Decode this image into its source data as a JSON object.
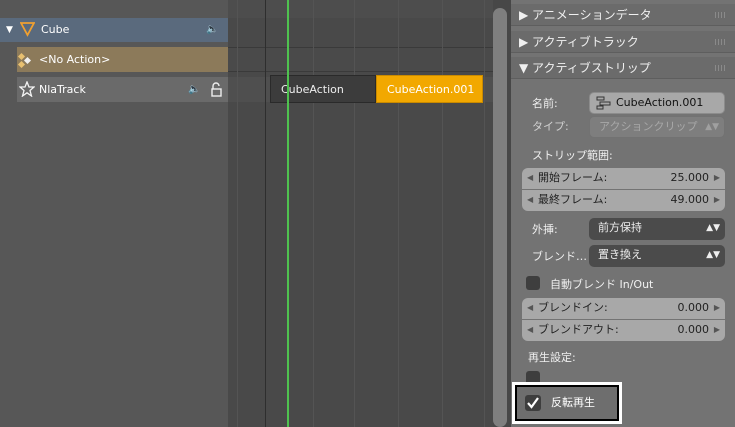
{
  "channels": {
    "object_label": "Cube",
    "action_label": "<No Action>",
    "track_label": "NlaTrack"
  },
  "strips": [
    {
      "label": "CubeAction"
    },
    {
      "label": "CubeAction.001"
    }
  ],
  "panel": {
    "sections": {
      "animation_data": "▶ アニメーションデータ",
      "active_track": "▶ アクティブトラック",
      "active_strip": "▼ アクティブストリップ"
    },
    "name_label": "名前:",
    "name_value": "CubeAction.001",
    "type_label": "タイプ:",
    "type_value": "アクションクリップ",
    "strip_range_label": "ストリップ範囲:",
    "start_frame_label": "開始フレーム:",
    "start_frame_value": "25.000",
    "end_frame_label": "最終フレーム:",
    "end_frame_value": "49.000",
    "extrapolation_label": "外挿:",
    "extrapolation_value": "前方保持",
    "blend_label": "ブレンド…",
    "blend_value": "置き換え",
    "auto_blend_label": "自動ブレンド In/Out",
    "blend_in_label": "ブレンドイン:",
    "blend_in_value": "0.000",
    "blend_out_label": "ブレンドアウト:",
    "blend_out_value": "0.000",
    "playback_label": "再生設定:",
    "reverse_label": "反転再生"
  },
  "colors": {
    "current_frame_line": "#4fc24f",
    "active_strip": "#f2a800",
    "highlight_border": "#ffffff"
  }
}
